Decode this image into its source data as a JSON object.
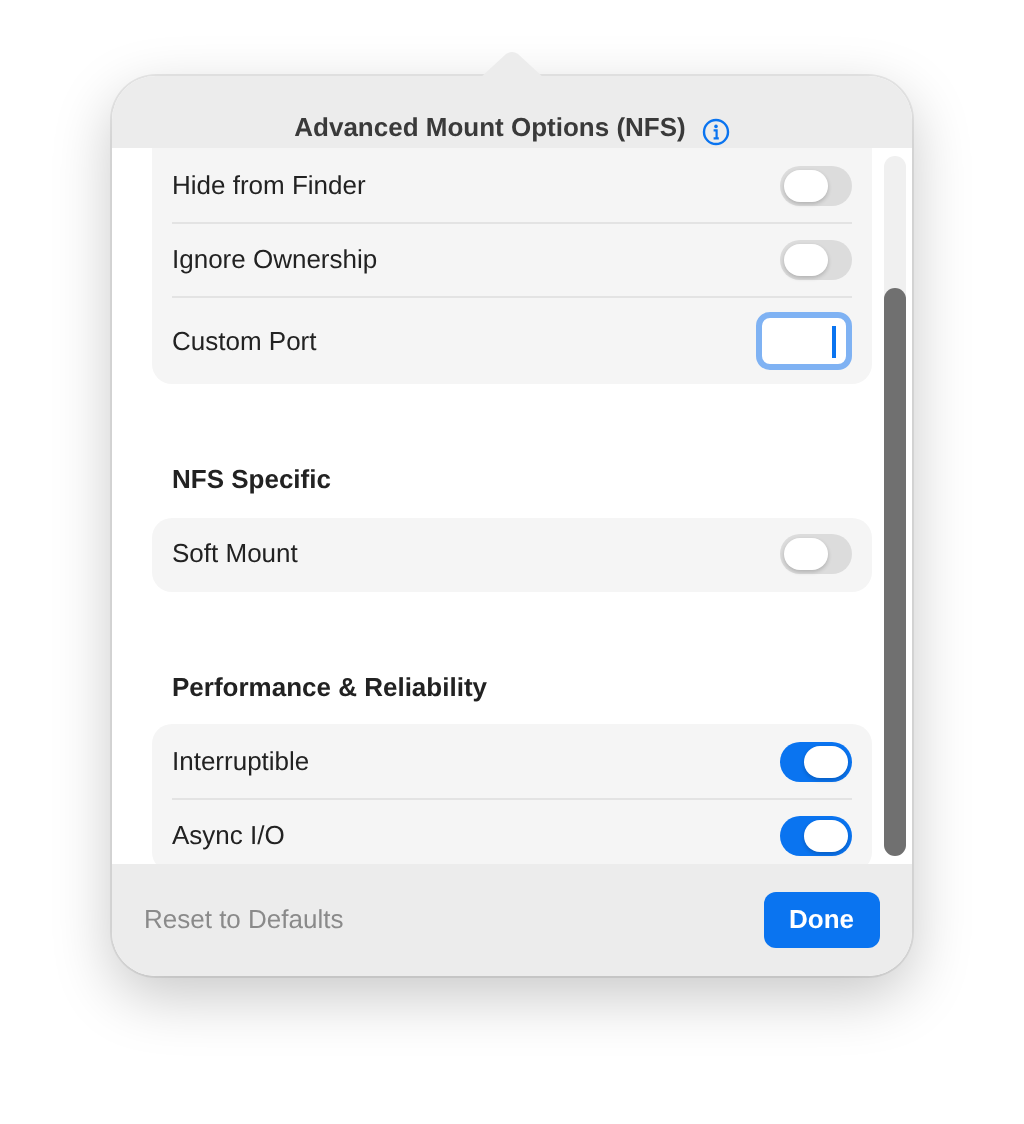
{
  "title": "Advanced Mount Options (NFS)",
  "sections": [
    {
      "rows": [
        {
          "kind": "toggle",
          "label": "Hide from Finder",
          "on": false
        },
        {
          "kind": "toggle",
          "label": "Ignore Ownership",
          "on": false
        },
        {
          "kind": "field",
          "label": "Custom Port",
          "focused": true
        }
      ]
    },
    {
      "heading": "NFS Specific",
      "rows": [
        {
          "kind": "toggle",
          "label": "Soft Mount",
          "on": false
        }
      ]
    },
    {
      "heading": "Performance & Reliability",
      "rows": [
        {
          "kind": "toggle",
          "label": "Interruptible",
          "on": true
        },
        {
          "kind": "toggle",
          "label": "Async I/O",
          "on": true
        }
      ]
    }
  ],
  "footer": {
    "reset": "Reset to Defaults",
    "done": "Done"
  }
}
